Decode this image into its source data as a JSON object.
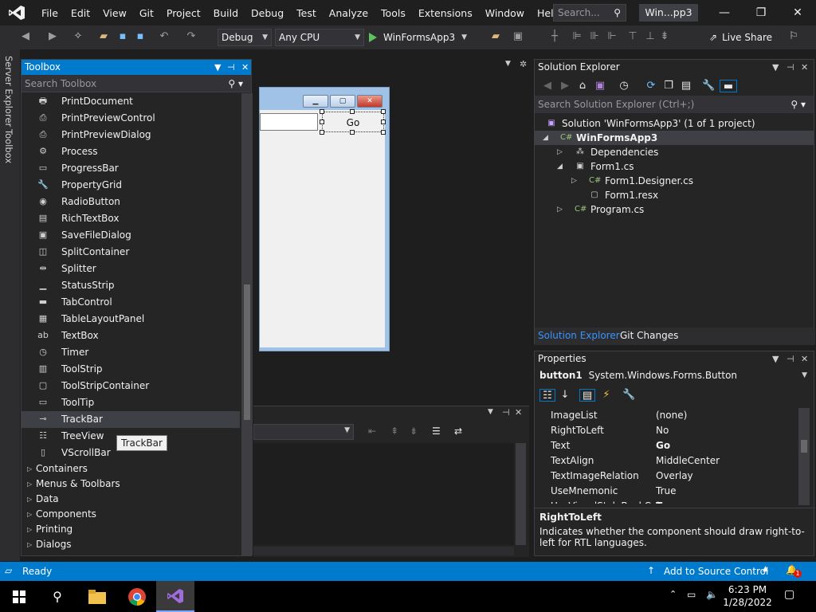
{
  "menu": [
    "File",
    "Edit",
    "View",
    "Git",
    "Project",
    "Build",
    "Debug",
    "Test",
    "Analyze",
    "Tools",
    "Extensions",
    "Window",
    "Help"
  ],
  "search": {
    "placeholder": "Search..."
  },
  "solution_title": "Win...pp3",
  "toolbar": {
    "config": "Debug",
    "platform": "Any CPU",
    "run_label": "WinFormsApp3",
    "live_share": "Live Share"
  },
  "rail": {
    "server_explorer": "Server Explorer",
    "toolbox": "Toolbox"
  },
  "toolbox": {
    "title": "Toolbox",
    "search_placeholder": "Search Toolbox",
    "items": [
      {
        "label": "PrintDocument",
        "icon": "print-document-icon",
        "glyph": "🖶"
      },
      {
        "label": "PrintPreviewControl",
        "icon": "print-preview-control-icon",
        "glyph": "⎙"
      },
      {
        "label": "PrintPreviewDialog",
        "icon": "print-preview-dialog-icon",
        "glyph": "⎙"
      },
      {
        "label": "Process",
        "icon": "process-icon",
        "glyph": "⚙"
      },
      {
        "label": "ProgressBar",
        "icon": "progress-bar-icon",
        "glyph": "▭"
      },
      {
        "label": "PropertyGrid",
        "icon": "property-grid-icon",
        "glyph": "🔧"
      },
      {
        "label": "RadioButton",
        "icon": "radio-button-icon",
        "glyph": "◉"
      },
      {
        "label": "RichTextBox",
        "icon": "rich-text-box-icon",
        "glyph": "▤"
      },
      {
        "label": "SaveFileDialog",
        "icon": "save-file-dialog-icon",
        "glyph": "▣"
      },
      {
        "label": "SplitContainer",
        "icon": "split-container-icon",
        "glyph": "◫"
      },
      {
        "label": "Splitter",
        "icon": "splitter-icon",
        "glyph": "⇹"
      },
      {
        "label": "StatusStrip",
        "icon": "status-strip-icon",
        "glyph": "▁"
      },
      {
        "label": "TabControl",
        "icon": "tab-control-icon",
        "glyph": "▬"
      },
      {
        "label": "TableLayoutPanel",
        "icon": "table-layout-panel-icon",
        "glyph": "▦"
      },
      {
        "label": "TextBox",
        "icon": "text-box-icon",
        "glyph": "ab"
      },
      {
        "label": "Timer",
        "icon": "timer-icon",
        "glyph": "◷"
      },
      {
        "label": "ToolStrip",
        "icon": "tool-strip-icon",
        "glyph": "▥"
      },
      {
        "label": "ToolStripContainer",
        "icon": "tool-strip-container-icon",
        "glyph": "▢"
      },
      {
        "label": "ToolTip",
        "icon": "tool-tip-icon",
        "glyph": "▭"
      },
      {
        "label": "TrackBar",
        "icon": "track-bar-icon",
        "glyph": "⊸"
      },
      {
        "label": "TreeView",
        "icon": "tree-view-icon",
        "glyph": "☷"
      },
      {
        "label": "VScrollBar",
        "icon": "vscroll-bar-icon",
        "glyph": "▯"
      }
    ],
    "selected_index": 19,
    "categories": [
      "Containers",
      "Menus & Toolbars",
      "Data",
      "Components",
      "Printing",
      "Dialogs"
    ],
    "tooltip": "TrackBar"
  },
  "form": {
    "button_text": "Go"
  },
  "solution_explorer": {
    "title": "Solution Explorer",
    "search_placeholder": "Search Solution Explorer (Ctrl+;)",
    "solution": "Solution 'WinFormsApp3' (1 of 1 project)",
    "project": "WinFormsApp3",
    "dependencies": "Dependencies",
    "form1": "Form1.cs",
    "form1_designer": "Form1.Designer.cs",
    "form1_resx": "Form1.resx",
    "program": "Program.cs",
    "tab_solution_explorer": "Solution Explorer",
    "tab_git_changes": "Git Changes"
  },
  "properties": {
    "title": "Properties",
    "object_name": "button1",
    "object_type": "System.Windows.Forms.Button",
    "rows": [
      {
        "key": "ImageList",
        "value": "(none)",
        "bold": false
      },
      {
        "key": "RightToLeft",
        "value": "No",
        "bold": false
      },
      {
        "key": "Text",
        "value": "Go",
        "bold": true
      },
      {
        "key": "TextAlign",
        "value": "MiddleCenter",
        "bold": false
      },
      {
        "key": "TextImageRelation",
        "value": "Overlay",
        "bold": false
      },
      {
        "key": "UseMnemonic",
        "value": "True",
        "bold": false
      },
      {
        "key": "UseVisualStyleBackColor",
        "value": "True",
        "bold": true
      }
    ],
    "desc_title": "RightToLeft",
    "desc_text": "Indicates whether the component should draw right-to-left for RTL languages."
  },
  "status": {
    "ready": "Ready",
    "source_control": "Add to Source Control",
    "notifications": "1"
  },
  "taskbar": {
    "time": "6:23 PM",
    "date": "1/28/2022"
  }
}
